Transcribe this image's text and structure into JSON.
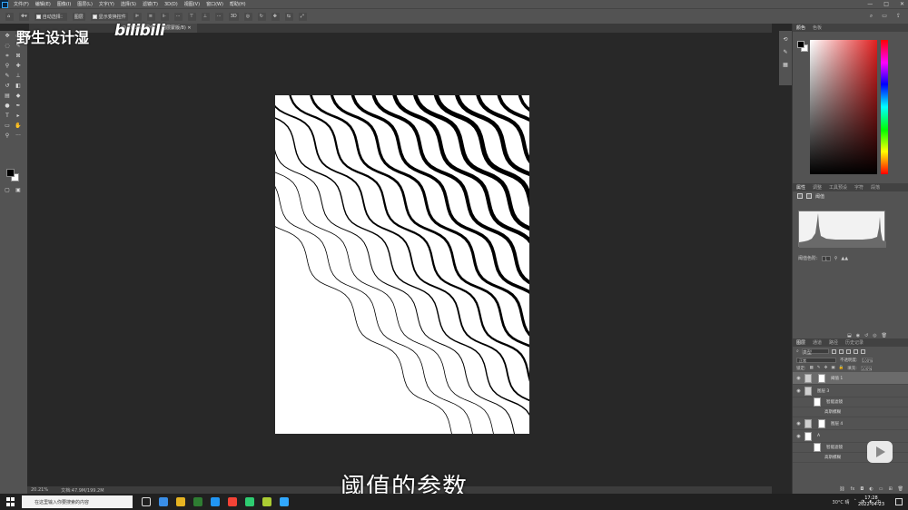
{
  "menu": {
    "items": [
      "文件(F)",
      "编辑(E)",
      "图像(I)",
      "图层(L)",
      "文字(Y)",
      "选择(S)",
      "滤镜(T)",
      "3D(D)",
      "视图(V)",
      "窗口(W)",
      "帮助(H)"
    ],
    "window_controls": [
      "—",
      "□",
      "✕"
    ]
  },
  "options": {
    "auto_select_label": "自动选择：",
    "auto_select_value": "图层",
    "transform_label": "显示变换控件"
  },
  "document": {
    "tab_label": "@ 20.2% (阈值 1, 图层蒙版/8)"
  },
  "status": {
    "zoom": "20.21%",
    "doc_size": "文档:47.9M/199.2M"
  },
  "color_panel": {
    "tabs": [
      "颜色",
      "色板"
    ]
  },
  "properties": {
    "tabs": [
      "属性",
      "调整",
      "工具预设",
      "字符",
      "段落"
    ],
    "adjustment_name": "阈值",
    "threshold_label": "阈值色阶:",
    "threshold_value": "1"
  },
  "layers": {
    "tabs": [
      "图层",
      "通道",
      "路径",
      "历史记录"
    ],
    "filter_label": "类型",
    "blend_mode": "正常",
    "opacity_label": "不透明度:",
    "opacity_value": "100%",
    "lock_label": "锁定:",
    "fill_label": "填充:",
    "fill_value": "100%",
    "rows": [
      {
        "name": "阈值 1",
        "kind": "adjustment",
        "selected": true
      },
      {
        "name": "图层 3",
        "kind": "smart",
        "selected": false
      },
      {
        "name": "智能滤镜",
        "kind": "sub",
        "selected": false
      },
      {
        "name": "高斯模糊",
        "kind": "sub",
        "selected": false
      },
      {
        "name": "图层 4",
        "kind": "group",
        "selected": false
      },
      {
        "name": "A",
        "kind": "smart",
        "selected": false
      },
      {
        "name": "智能滤镜",
        "kind": "sub",
        "selected": false
      },
      {
        "name": "高斯模糊",
        "kind": "sub",
        "selected": false
      }
    ]
  },
  "overlay": {
    "watermark": "野生设计湿",
    "bili_logo": "bilibili",
    "subtitle": "阈值的参数"
  },
  "taskbar": {
    "search_placeholder": "在这里输入你要搜索的内容",
    "weather": "30°C 晴",
    "time": "17:28",
    "date": "2022-04-23",
    "app_colors": [
      "#3a8ee6",
      "#e6b422",
      "#2e7d32",
      "#2196f3",
      "#f44336",
      "#2ecc71",
      "#aacc33",
      "#31a8ff"
    ]
  }
}
